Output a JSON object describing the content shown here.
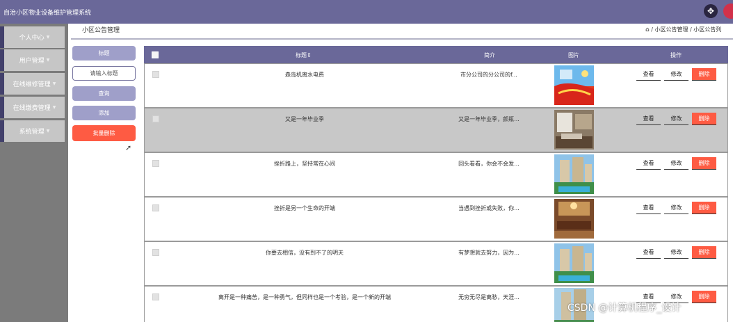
{
  "header": {
    "title": "自治小区物业设备维护管理系统"
  },
  "sidebar": {
    "items": [
      {
        "label": "个人中心"
      },
      {
        "label": "用户管理"
      },
      {
        "label": "在线维修管理"
      },
      {
        "label": "在线缴费管理"
      },
      {
        "label": "系统管理"
      }
    ]
  },
  "page": {
    "title": "小区公告管理",
    "breadcrumb": {
      "path": "/ 小区公告管理 / 小区公告列"
    }
  },
  "controls": {
    "title_label": "标题",
    "search_placeholder": "请输入标题",
    "search_button": "查询",
    "add_button": "添加",
    "batch_delete_button": "批量删除"
  },
  "table": {
    "columns": {
      "title": "标题",
      "brief": "简介",
      "image": "图片",
      "actions": "操作"
    },
    "rows": [
      {
        "title": "森岛机离水电费",
        "brief": "市分公司的分公司的f...",
        "image": "festive-red-banner",
        "selected": false
      },
      {
        "title": "又是一年毕业季",
        "brief": "又是一年毕业季，颜瓶...",
        "image": "interior-room",
        "selected": true
      },
      {
        "title": "挫折路上，坚持常在心间",
        "brief": "回头看看，你会不会发...",
        "image": "apartment-pool",
        "selected": false
      },
      {
        "title": "挫折是另一个生命的开端",
        "brief": "当遇到挫折或失败，你...",
        "image": "living-room",
        "selected": false
      },
      {
        "title": "你要去相信，没有到不了的明天",
        "brief": "有梦想就去努力，因为...",
        "image": "apartment-pool",
        "selected": false
      },
      {
        "title": "离开是一种痛苦，是一种勇气，但同样也是一个考验，是一个新的开端",
        "brief": "无穷无尽是离愁，天涯...",
        "image": "apartment-building",
        "selected": false
      }
    ],
    "actions": {
      "view": "查看",
      "edit": "修改",
      "delete": "删除"
    }
  },
  "watermark": "CSDN @计算机程序_设计",
  "colors": {
    "header": "#6a6899",
    "sidebar_accent": "#42406b",
    "danger": "#fe5b43",
    "button": "#9f9fc9"
  }
}
